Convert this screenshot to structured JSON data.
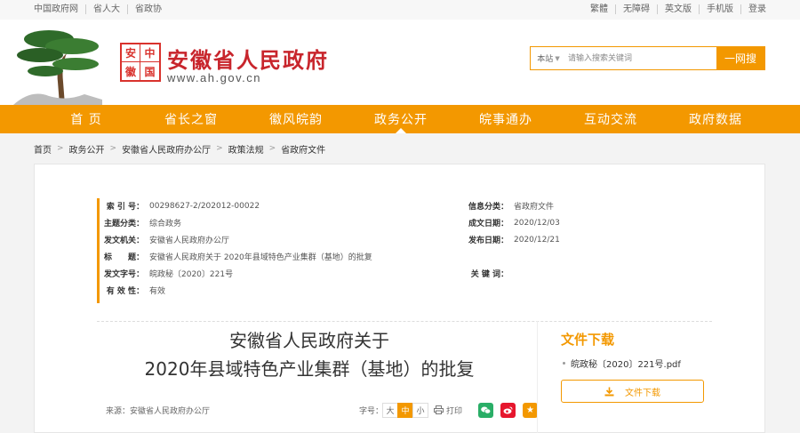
{
  "topbar": {
    "left_links": [
      "中国政府网",
      "省人大",
      "省政协"
    ],
    "right_links": [
      "繁體",
      "无障碍",
      "英文版",
      "手机版",
      "登录"
    ]
  },
  "header": {
    "seal_chars": [
      "安",
      "中",
      "徽",
      "国"
    ],
    "title": "安徽省人民政府",
    "url": "www.ah.gov.cn"
  },
  "search": {
    "scope": "本站",
    "placeholder": "请输入搜索关键词",
    "button": "一网搜"
  },
  "nav": {
    "items": [
      "首 页",
      "省长之窗",
      "徽风皖韵",
      "政务公开",
      "皖事通办",
      "互动交流",
      "政府数据"
    ],
    "active_index": 3
  },
  "breadcrumb": [
    "首页",
    "政务公开",
    "安徽省人民政府办公厅",
    "政策法规",
    "省政府文件"
  ],
  "meta": {
    "index_no": {
      "label": "索 引 号：",
      "value": "00298627-2/202012-00022"
    },
    "topic": {
      "label": "主题分类：",
      "value": "综合政务"
    },
    "issuer": {
      "label": "发文机关：",
      "value": "安徽省人民政府办公厅"
    },
    "title": {
      "label": "标　　题：",
      "value": "安徽省人民政府关于 2020年县域特色产业集群（基地）的批复"
    },
    "doc_no": {
      "label": "发文字号：",
      "value": "皖政秘〔2020〕221号"
    },
    "validity": {
      "label": "有 效 性：",
      "value": "有效"
    },
    "info_class": {
      "label": "信息分类：",
      "value": "省政府文件"
    },
    "created": {
      "label": "成文日期：",
      "value": "2020/12/03"
    },
    "published": {
      "label": "发布日期：",
      "value": "2020/12/21"
    },
    "keywords": {
      "label": "关 键 词：",
      "value": ""
    }
  },
  "document": {
    "title_line1": "安徽省人民政府关于",
    "title_line2": "2020年县域特色产业集群（基地）的批复",
    "source": "来源：安徽省人民政府办公厅",
    "font_size_label": "字号：",
    "font_sizes": [
      "大",
      "中",
      "小"
    ],
    "font_size_active": 1,
    "print_label": "打印"
  },
  "download": {
    "title": "文件下载",
    "file_name": "皖政秘〔2020〕221号.pdf",
    "button": "文件下载"
  },
  "colors": {
    "brand_orange": "#f39800",
    "brand_red": "#c8252c",
    "wechat_green": "#2aae67",
    "weibo_red": "#e6162d"
  }
}
